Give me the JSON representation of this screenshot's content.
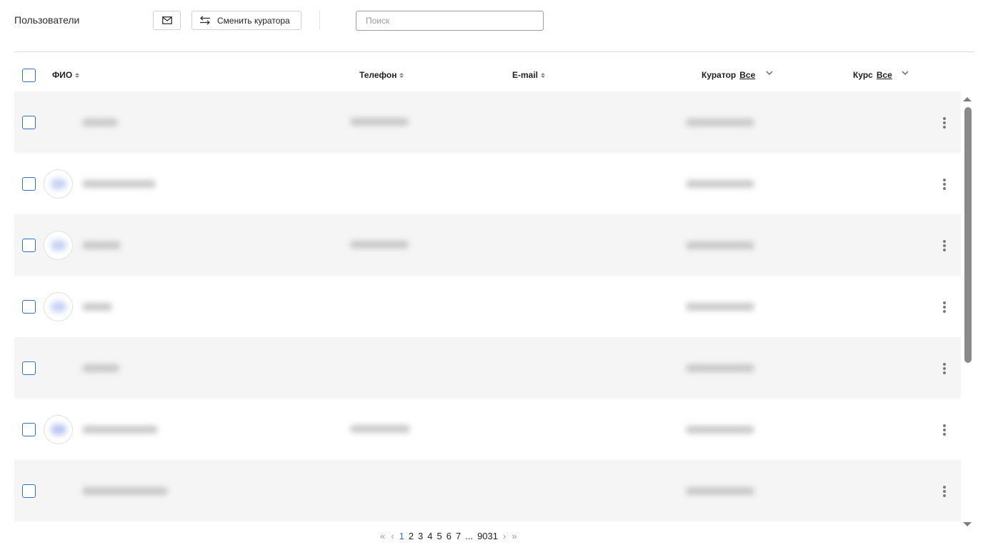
{
  "toolbar": {
    "title": "Пользователи",
    "mail_icon": "envelope-icon",
    "change_curator_icon": "swap-arrows-icon",
    "change_curator_label": "Сменить куратора",
    "search_placeholder": "Поиск",
    "search_value": ""
  },
  "table": {
    "columns": {
      "name": "ФИО",
      "phone": "Телефон",
      "email": "E-mail",
      "curator": "Куратор",
      "curator_filter": "Все",
      "course": "Курс",
      "course_filter": "Все"
    },
    "rows": [
      {
        "has_avatar": false
      },
      {
        "has_avatar": true
      },
      {
        "has_avatar": true
      },
      {
        "has_avatar": true
      },
      {
        "has_avatar": false
      },
      {
        "has_avatar": true
      },
      {
        "has_avatar": false
      }
    ]
  },
  "pagination": {
    "first": "«",
    "prev": "‹",
    "pages": [
      "1",
      "2",
      "3",
      "4",
      "5",
      "6",
      "7"
    ],
    "current": "1",
    "ellipsis": "...",
    "last_page": "9031",
    "next": "›",
    "last": "»"
  },
  "colors": {
    "accent": "#2f6fcb",
    "row_alt": "#f5f5f5",
    "divider": "#d9d9d9"
  }
}
